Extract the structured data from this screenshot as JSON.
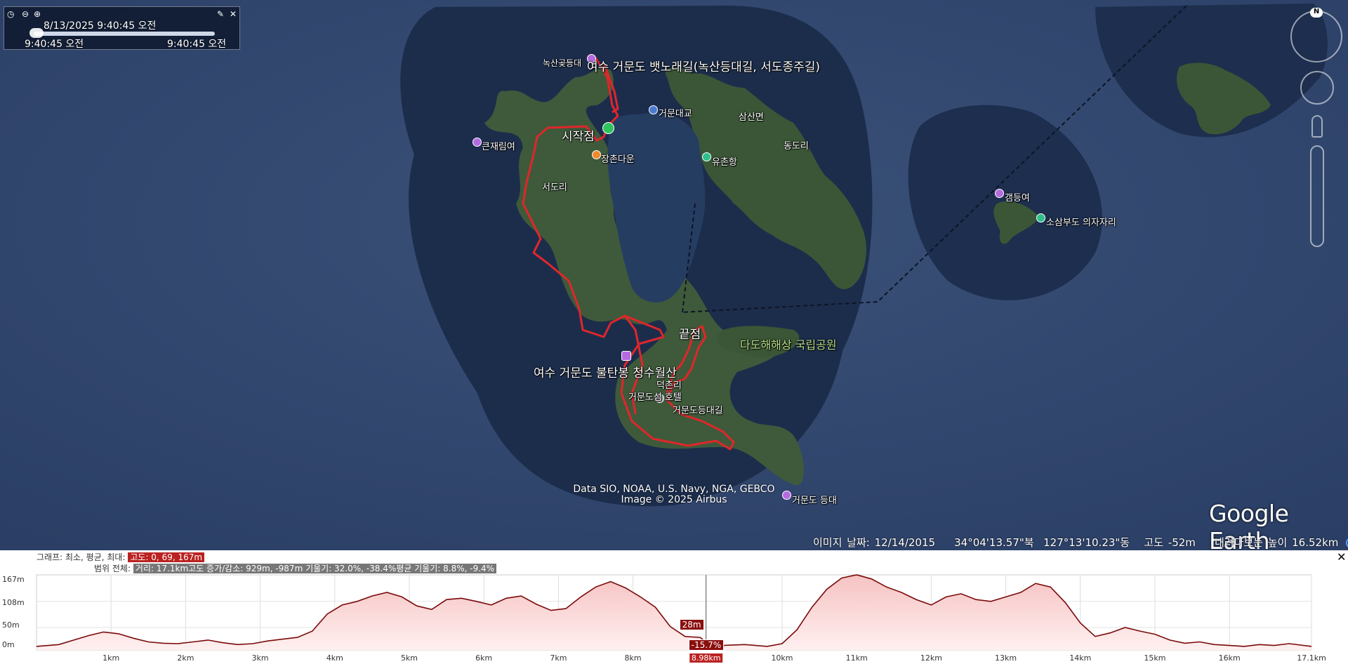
{
  "time_slider": {
    "current": "8/13/2025   9:40:45 오전",
    "start": "9:40:45 오전",
    "end": "9:40:45 오전"
  },
  "map_labels": {
    "route_title": "여수 거문도 뱃노래길(녹산등대길, 서도종주길)",
    "noksan": "녹산곶등대",
    "bigjae": "큰재림여",
    "start": "시작점",
    "seodori": "서도리",
    "jangchon": "장촌다운",
    "bridge": "거문대교",
    "samsan": "삼산면",
    "dongdori": "동도리",
    "yuchon": "유촌항",
    "end": "끝점",
    "park": "다도해해상 국립공원",
    "mountain": "여수 거문도 불탄봉 청수월산",
    "deokchon": "덕촌리",
    "hotel": "거문도섬 호텔",
    "trail": "거문도등대길",
    "lighthouse": "거문도 등대",
    "gamdeung": "갬등여",
    "sosam": "소삼부도 의자자리"
  },
  "attribution": {
    "line1": "Data SIO, NOAA, U.S. Navy, NGA, GEBCO",
    "line2": "Image © 2025 Airbus"
  },
  "logo": "Google Earth",
  "status": {
    "image_date": "이미지 날짜: 12/14/2015",
    "lat": "34°04'13.57\"북",
    "lon": "127°13'10.23\"동",
    "alt": "고도   -52m",
    "eye": "내려다보는 높이   16.52km"
  },
  "elevation": {
    "graph_label": "그래프: 최소, 평균, 최대:",
    "graph_value": "고도: 0, 69, 167m",
    "range_label": "범위 전체:",
    "range_value": "거리: 17.1km고도 증가/감소: 929m, -987m 기울기: 32.0%, -38.4%평균 기울기: 8.8%, -9.4%",
    "cursor_alt": "28m",
    "cursor_slope": "-15.7%",
    "cursor_dist": "8.98km",
    "y_labels": [
      "167m",
      "108m",
      "50m",
      "0m"
    ]
  },
  "chart_data": {
    "type": "area",
    "title": "",
    "xlabel": "",
    "ylabel": "",
    "x_tick_labels": [
      "1km",
      "2km",
      "3km",
      "4km",
      "5km",
      "6km",
      "7km",
      "8km",
      "10km",
      "11km",
      "12km",
      "13km",
      "14km",
      "15km",
      "16km",
      "17.1km"
    ],
    "xlim": [
      0,
      17.1
    ],
    "ylim": [
      0,
      167
    ],
    "cursor_x": 8.98,
    "series": [
      {
        "x": [
          0,
          0.3,
          0.5,
          0.7,
          0.9,
          1.1,
          1.3,
          1.5,
          1.7,
          1.9,
          2.1,
          2.3,
          2.5,
          2.7,
          2.9,
          3.1,
          3.3,
          3.5,
          3.7,
          3.9,
          4.1,
          4.3,
          4.5,
          4.7,
          4.9,
          5.1,
          5.3,
          5.5,
          5.7,
          5.9,
          6.1,
          6.3,
          6.5,
          6.7,
          6.9,
          7.1,
          7.3,
          7.5,
          7.7,
          7.9,
          8.1,
          8.3,
          8.5,
          8.7,
          8.9,
          9.0,
          9.2,
          9.5,
          9.8,
          10.0,
          10.2,
          10.4,
          10.6,
          10.8,
          11.0,
          11.2,
          11.4,
          11.6,
          11.8,
          12.0,
          12.2,
          12.4,
          12.6,
          12.8,
          13.0,
          13.2,
          13.4,
          13.6,
          13.8,
          14.0,
          14.2,
          14.4,
          14.6,
          14.8,
          15.0,
          15.2,
          15.4,
          15.6,
          15.8,
          16.0,
          16.2,
          16.4,
          16.6,
          16.8,
          17.1
        ],
        "y": [
          8,
          12,
          22,
          32,
          40,
          36,
          26,
          18,
          15,
          14,
          18,
          22,
          16,
          12,
          14,
          20,
          24,
          28,
          42,
          80,
          100,
          108,
          120,
          128,
          118,
          98,
          90,
          112,
          115,
          108,
          100,
          115,
          120,
          102,
          88,
          92,
          118,
          140,
          152,
          138,
          118,
          95,
          52,
          30,
          28,
          15,
          10,
          12,
          8,
          14,
          45,
          95,
          135,
          160,
          167,
          158,
          140,
          128,
          112,
          100,
          118,
          125,
          112,
          108,
          118,
          128,
          148,
          140,
          105,
          60,
          30,
          38,
          50,
          42,
          35,
          22,
          15,
          18,
          12,
          10,
          8,
          12,
          10,
          14,
          8
        ]
      }
    ]
  }
}
